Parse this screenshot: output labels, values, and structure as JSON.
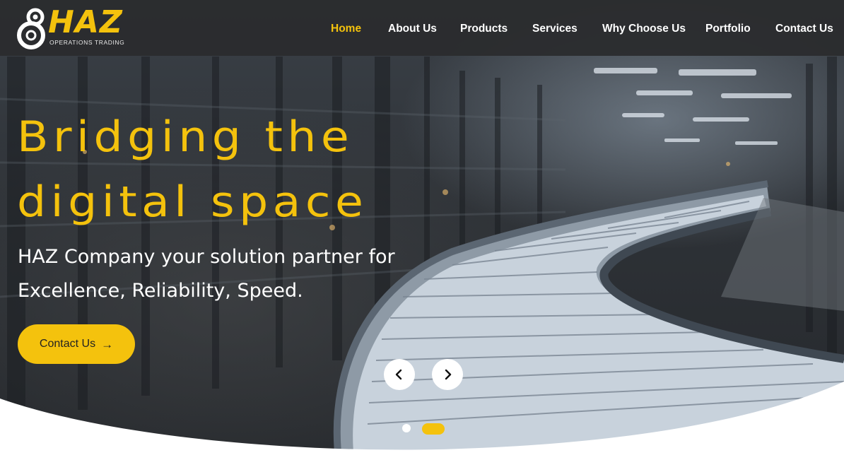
{
  "brand": {
    "name": "HAZ",
    "tagline": "OPERATIONS TRADING",
    "accent_color": "#f4c20d",
    "header_color": "#2a2c2e"
  },
  "nav": {
    "items": [
      {
        "label": "Home",
        "active": true
      },
      {
        "label": "About Us",
        "active": false
      },
      {
        "label": "Products",
        "active": false
      },
      {
        "label": "Services",
        "active": false
      },
      {
        "label": "Why Choose Us",
        "active": false
      },
      {
        "label": "Portfolio",
        "active": false
      },
      {
        "label": "Contact Us",
        "active": false
      }
    ]
  },
  "hero": {
    "headline_line1": "Bridging the",
    "headline_line2": "digital space",
    "subline_line1": "HAZ Company your solution partner for",
    "subline_line2": "Excellence, Reliability, Speed.",
    "cta_label": "Contact Us",
    "cta_icon": "arrow-right-icon",
    "background": "warehouse-conveyor-image"
  },
  "slider": {
    "prev_icon": "chevron-left-icon",
    "next_icon": "chevron-right-icon",
    "slide_count": 2,
    "active_slide": 2
  }
}
